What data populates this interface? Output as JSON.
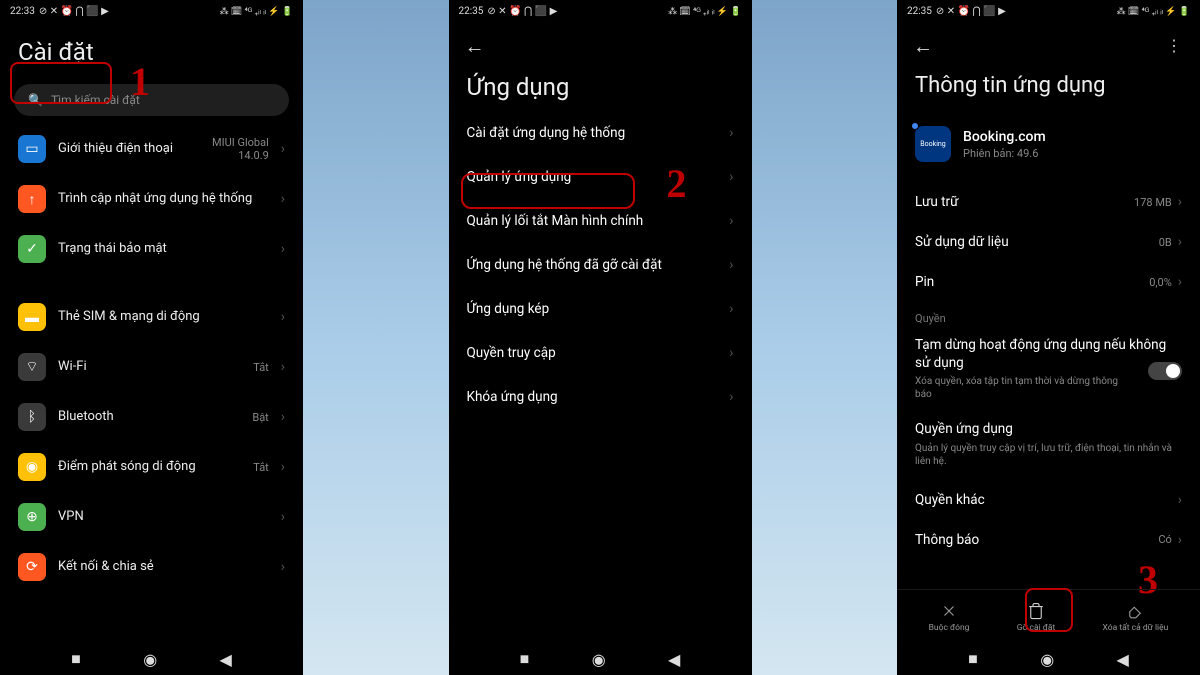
{
  "step_numbers": {
    "s1": "1",
    "s2": "2",
    "s3": "3"
  },
  "p1": {
    "time": "22:33",
    "status_icons": "⊘ ✕ ⏰ ⋂ ⬛ ▶",
    "status_right": "⁂ 🗓 ⁴ᴳ ₊ᵢₗ ᵢₗ ⚡ 🔋",
    "title": "Cài đặt",
    "search_placeholder": "Tìm kiếm cài đặt",
    "rows": [
      {
        "icon_bg": "#1976d2",
        "icon": "📱",
        "label": "Giới thiệu điện thoại",
        "value": "MIUI Global\n14.0.9"
      },
      {
        "icon_bg": "#ff5722",
        "icon": "⬆",
        "label": "Trình cập nhật ứng dụng hệ thống",
        "value": ""
      },
      {
        "icon_bg": "#4caf50",
        "icon": "✓",
        "label": "Trạng thái bảo mật",
        "value": ""
      }
    ],
    "rows2": [
      {
        "icon_bg": "#ffc107",
        "icon": "📶",
        "label": "Thẻ SIM & mạng di động",
        "value": ""
      },
      {
        "icon_bg": "#e0e0e0",
        "icon": "📶",
        "label": "Wi-Fi",
        "value": "Tắt"
      },
      {
        "icon_bg": "#e0e0e0",
        "icon": "ᛒ",
        "label": "Bluetooth",
        "value": "Bật"
      },
      {
        "icon_bg": "#ffc107",
        "icon": "◉",
        "label": "Điểm phát sóng di động",
        "value": "Tắt"
      },
      {
        "icon_bg": "#4caf50",
        "icon": "⊕",
        "label": "VPN",
        "value": ""
      },
      {
        "icon_bg": "#ff5722",
        "icon": "⟳",
        "label": "Kết nối & chia sẻ",
        "value": ""
      }
    ]
  },
  "p2": {
    "time": "22:35",
    "title": "Ứng dụng",
    "rows": [
      "Cài đặt ứng dụng hệ thống",
      "Quản lý ứng dụng",
      "Quản lý lối tắt Màn hình chính",
      "Ứng dụng hệ thống đã gỡ cài đặt",
      "Ứng dụng kép",
      "Quyền truy cập",
      "Khóa ứng dụng"
    ]
  },
  "p3": {
    "time": "22:35",
    "title": "Thông tin ứng dụng",
    "app_name": "Booking.com",
    "app_version": "Phiên bản: 49.6",
    "app_icon_text": "Booking",
    "info": [
      {
        "label": "Lưu trữ",
        "value": "178 MB"
      },
      {
        "label": "Sử dụng dữ liệu",
        "value": "0B"
      },
      {
        "label": "Pin",
        "value": "0,0%"
      }
    ],
    "perm_section": "Quyền",
    "perm1_title": "Tạm dừng hoạt động ứng dụng nếu không sử dụng",
    "perm1_desc": "Xóa quyền, xóa tập tin tạm thời và dừng thông báo",
    "perm2_title": "Quyền ứng dụng",
    "perm2_desc": "Quản lý quyền truy cập vị trí, lưu trữ, điện thoại, tin nhắn và liên hệ.",
    "other_perm": "Quyền khác",
    "notif_label": "Thông báo",
    "notif_value": "Có",
    "actions": [
      {
        "label": "Buộc đóng"
      },
      {
        "label": "Gỡ cài đặt"
      },
      {
        "label": "Xóa tất cả dữ liệu"
      }
    ]
  }
}
